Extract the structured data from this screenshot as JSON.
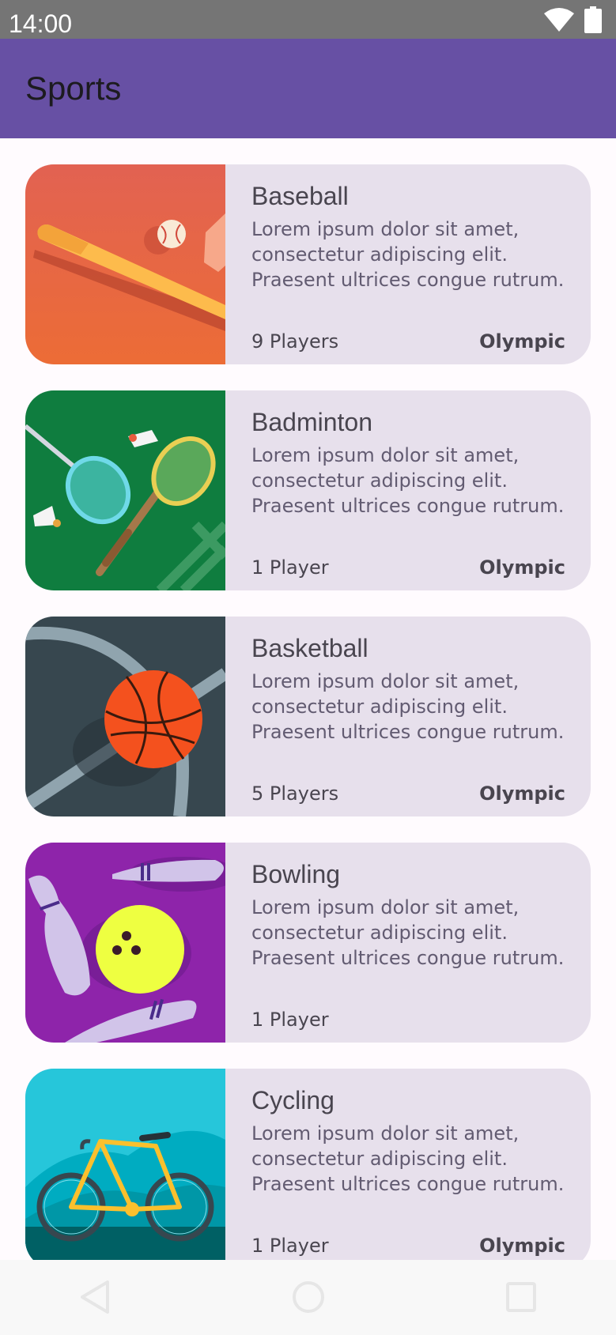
{
  "status_bar": {
    "time": "14:00",
    "icons": [
      "wifi-icon",
      "battery-icon"
    ]
  },
  "app_bar": {
    "title": "Sports",
    "color": "#6750a4"
  },
  "sports": [
    {
      "title": "Baseball",
      "description": "Lorem ipsum dolor sit amet, consectetur adipiscing elit. Praesent ultrices congue rutrum.",
      "players": "9 Players",
      "olympic": "Olympic",
      "image": "baseball-image"
    },
    {
      "title": "Badminton",
      "description": "Lorem ipsum dolor sit amet, consectetur adipiscing elit. Praesent ultrices congue rutrum.",
      "players": "1 Player",
      "olympic": "Olympic",
      "image": "badminton-image"
    },
    {
      "title": "Basketball",
      "description": "Lorem ipsum dolor sit amet, consectetur adipiscing elit. Praesent ultrices congue rutrum.",
      "players": "5 Players",
      "olympic": "Olympic",
      "image": "basketball-image"
    },
    {
      "title": "Bowling",
      "description": "Lorem ipsum dolor sit amet, consectetur adipiscing elit. Praesent ultrices congue rutrum.",
      "players": "1 Player",
      "olympic": "",
      "image": "bowling-image"
    },
    {
      "title": "Cycling",
      "description": "Lorem ipsum dolor sit amet, consectetur adipiscing elit. Praesent ultrices congue rutrum.",
      "players": "1 Player",
      "olympic": "Olympic",
      "image": "cycling-image"
    }
  ],
  "nav_bar": {
    "icons": [
      "back-icon",
      "home-icon",
      "recents-icon"
    ]
  }
}
